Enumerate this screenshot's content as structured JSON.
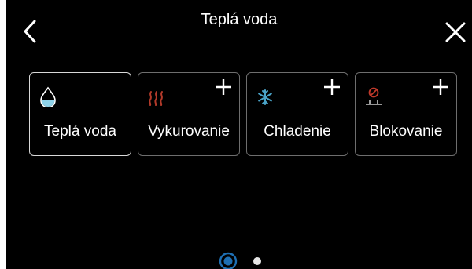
{
  "header": {
    "title": "Teplá voda"
  },
  "tiles": [
    {
      "label": "Teplá voda",
      "icon": "water-drop-icon",
      "selected": true,
      "has_add": false,
      "icon_color": "#8fd3ea"
    },
    {
      "label": "Vykurovanie",
      "icon": "heating-icon",
      "selected": false,
      "has_add": true,
      "icon_color": "#b33a2a"
    },
    {
      "label": "Chladenie",
      "icon": "snowflake-icon",
      "selected": false,
      "has_add": true,
      "icon_color": "#4aa3c8"
    },
    {
      "label": "Blokovanie",
      "icon": "blocking-icon",
      "selected": false,
      "has_add": true,
      "icon_color": "#c0392b"
    }
  ],
  "pager": {
    "pages": 2,
    "current": 1,
    "active_color": "#1e6fb3"
  }
}
